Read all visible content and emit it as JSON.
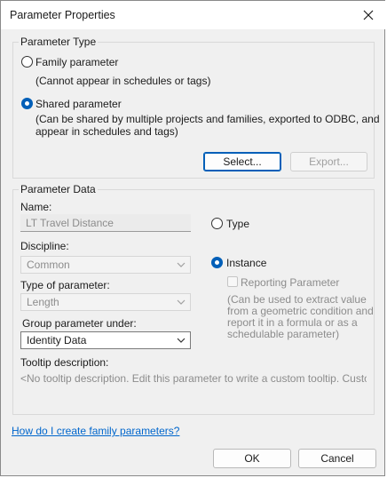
{
  "window": {
    "title": "Parameter Properties",
    "close_icon": "close-icon"
  },
  "parameter_type": {
    "group_label": "Parameter Type",
    "family_label": "Family parameter",
    "family_note": "(Cannot appear in schedules or tags)",
    "shared_label": "Shared parameter",
    "shared_note_line1": "(Can be shared by multiple projects and families, exported to ODBC, and",
    "shared_note_line2": "appear in schedules and tags)",
    "select_button": "Select...",
    "export_button": "Export..."
  },
  "parameter_data": {
    "group_label": "Parameter Data",
    "name_label": "Name:",
    "name_value": "LT Travel Distance",
    "discipline_label": "Discipline:",
    "discipline_value": "Common",
    "type_label": "Type of parameter:",
    "type_value": "Length",
    "group_under_label": "Group parameter under:",
    "group_under_value": "Identity Data",
    "tooltip_label": "Tooltip description:",
    "tooltip_value": "<No tooltip description. Edit this parameter to write a custom tooltip. Custom",
    "type_radio_label": "Type",
    "instance_radio_label": "Instance",
    "reporting_label": "Reporting Parameter",
    "reporting_note_line1": "(Can be used to extract value",
    "reporting_note_line2": "from a geometric condition and",
    "reporting_note_line3": "report it in a formula or as a",
    "reporting_note_line4": "schedulable parameter)"
  },
  "footer": {
    "help_link": "How do I create family parameters?",
    "ok_button": "OK",
    "cancel_button": "Cancel"
  },
  "colors": {
    "accent": "#005fb8",
    "link": "#0066cc",
    "disabled": "#8c8c8c"
  }
}
